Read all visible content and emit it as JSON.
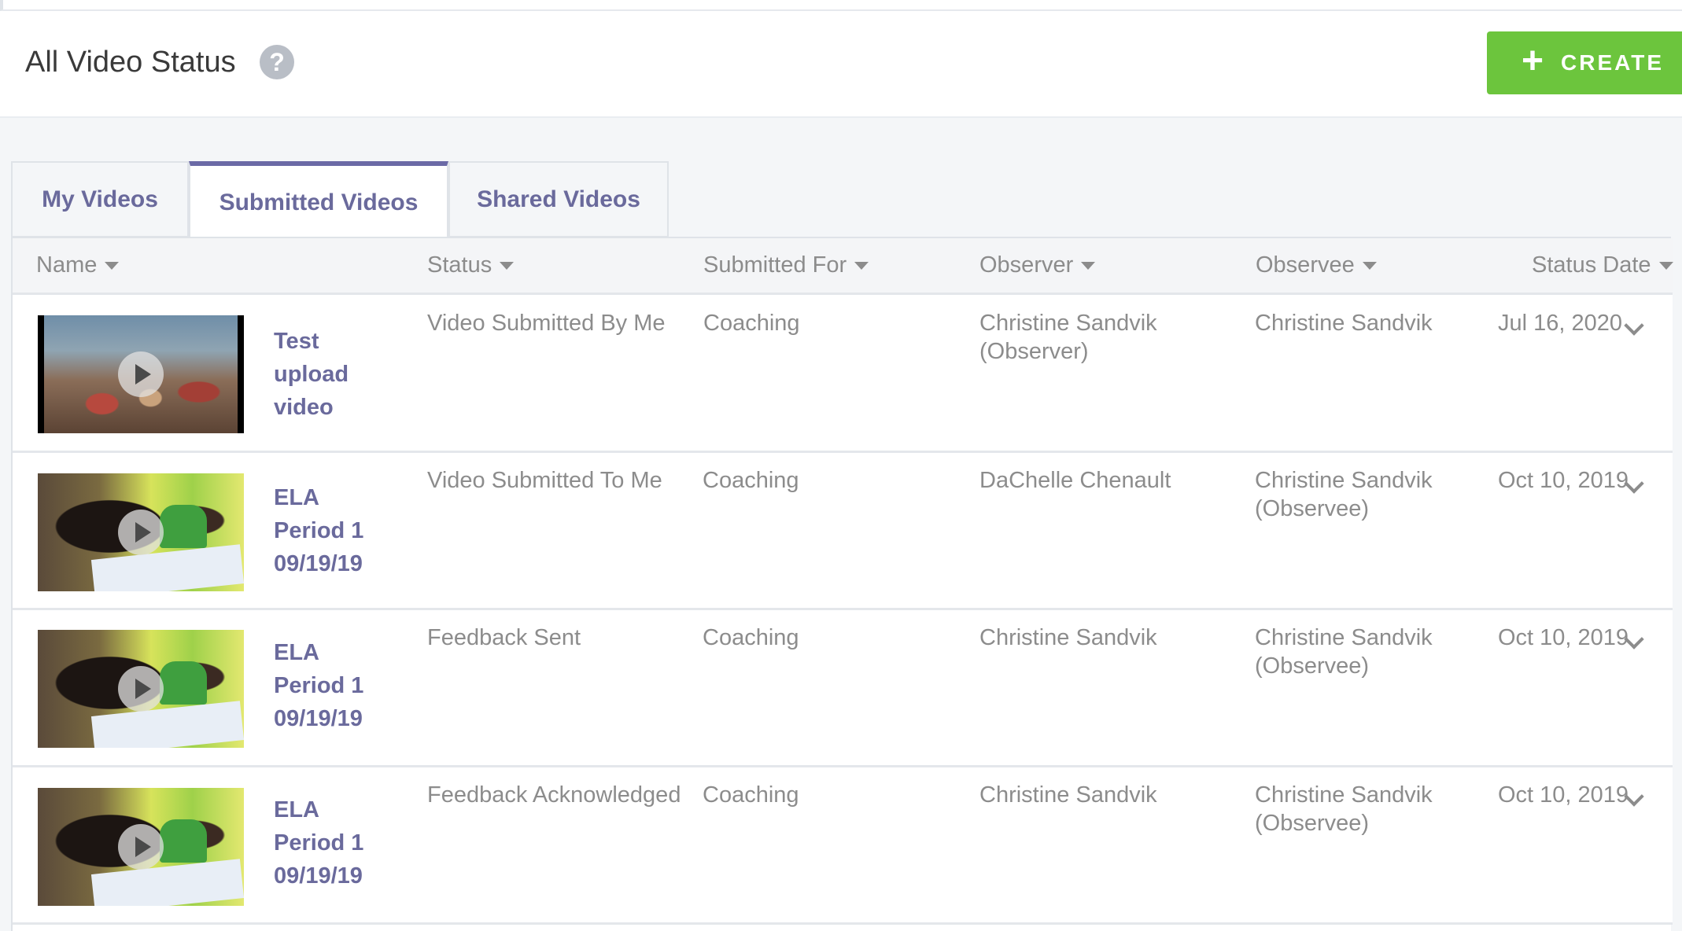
{
  "header": {
    "title": "All Video Status",
    "help_icon": "?",
    "create_label": "CREATE",
    "create_icon": "+"
  },
  "tabs": [
    {
      "label": "My Videos",
      "active": false
    },
    {
      "label": "Submitted Videos",
      "active": true
    },
    {
      "label": "Shared Videos",
      "active": false
    }
  ],
  "table": {
    "columns": [
      "Name",
      "Status",
      "Submitted For",
      "Observer",
      "Observee",
      "Status Date"
    ],
    "rows": [
      {
        "name": "Test upload video",
        "thumbnail": "classroom-thumbnail",
        "status": "Video Submitted By Me",
        "submitted_for": "Coaching",
        "observer": "Christine Sandvik (Observer)",
        "observee": "Christine Sandvik",
        "status_date": "Jul 16, 2020"
      },
      {
        "name": "ELA Period 1 09/19/19",
        "thumbnail": "student-writing-thumbnail",
        "status": "Video Submitted To Me",
        "submitted_for": "Coaching",
        "observer": "DaChelle Chenault",
        "observee": "Christine Sandvik (Observee)",
        "status_date": "Oct 10, 2019"
      },
      {
        "name": "ELA Period 1 09/19/19",
        "thumbnail": "student-writing-thumbnail",
        "status": "Feedback Sent",
        "submitted_for": "Coaching",
        "observer": "Christine Sandvik",
        "observee": "Christine Sandvik (Observee)",
        "status_date": "Oct 10, 2019"
      },
      {
        "name": "ELA Period 1 09/19/19",
        "thumbnail": "student-writing-thumbnail",
        "status": "Feedback Acknowledged",
        "submitted_for": "Coaching",
        "observer": "Christine Sandvik",
        "observee": "Christine Sandvik (Observee)",
        "status_date": "Oct 10, 2019"
      }
    ]
  },
  "colors": {
    "accent_purple": "#6a6a9c",
    "create_green": "#6cc53d",
    "muted_text": "#8c8c8c"
  }
}
